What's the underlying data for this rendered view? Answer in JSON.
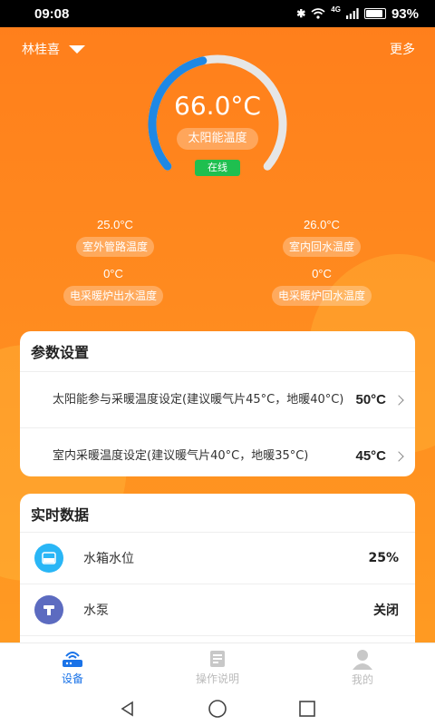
{
  "status_bar": {
    "time": "09:08",
    "icons": [
      "bluetooth-icon",
      "wifi-icon",
      "signal-icon",
      "battery-icon"
    ],
    "network_label": "4G",
    "battery_percent": "93%",
    "battery_level": 0.93
  },
  "header": {
    "user_name": "林桂喜",
    "more_label": "更多"
  },
  "gauge": {
    "temperature": "66.0°C",
    "label": "太阳能温度",
    "status": "在线",
    "fill_fraction": 0.45,
    "colors": {
      "fill": "#1e88e5",
      "track": "#e6e6e6",
      "online": "#1fbf4f"
    }
  },
  "metrics": [
    {
      "value": "25.0°C",
      "label": "室外管路温度"
    },
    {
      "value": "26.0°C",
      "label": "室内回水温度"
    },
    {
      "value": "0°C",
      "label": "电采暖炉出水温度"
    },
    {
      "value": "0°C",
      "label": "电采暖炉回水温度"
    }
  ],
  "params": {
    "title": "参数设置",
    "rows": [
      {
        "text": "太阳能参与采暖温度设定(建议暖气片45°C，地暖40°C)",
        "value": "50°C"
      },
      {
        "text": "室内采暖温度设定(建议暖气片40°C，地暖35°C)",
        "value": "45°C"
      }
    ]
  },
  "realtime": {
    "title": "实时数据",
    "rows": [
      {
        "name": "水箱水位",
        "value": "25%",
        "icon": "water-tank-icon",
        "color": "#29b6f6"
      },
      {
        "name": "水泵",
        "value": "关闭",
        "icon": "pump-icon",
        "color": "#5c6bc0"
      },
      {
        "name": "",
        "value": "",
        "icon": "partial-icon",
        "color": "#f9a825"
      }
    ]
  },
  "tabs": [
    {
      "label": "设备",
      "icon": "router-icon",
      "active": true
    },
    {
      "label": "操作说明",
      "icon": "manual-icon",
      "active": false
    },
    {
      "label": "我的",
      "icon": "user-icon",
      "active": false
    }
  ],
  "accent_color": "#1a73e8"
}
